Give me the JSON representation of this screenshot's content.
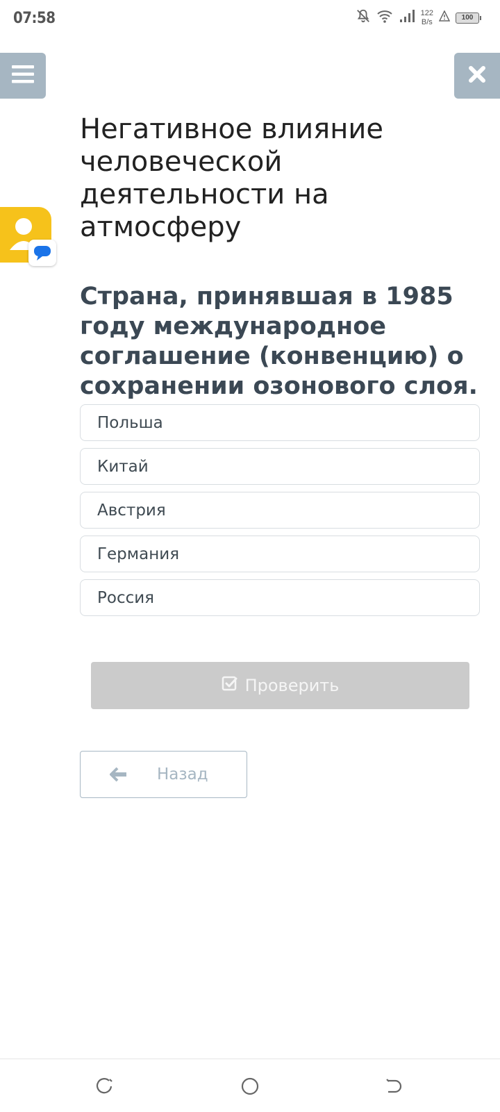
{
  "status_bar": {
    "time": "07:58",
    "net_speed_value": "122",
    "net_speed_unit": "B/s",
    "battery": "100",
    "icons": [
      "bell-off-icon",
      "wifi-icon",
      "signal-icon",
      "alert-icon",
      "battery-icon"
    ]
  },
  "header": {
    "menu_icon": "hamburger-icon",
    "close_icon": "close-icon"
  },
  "lesson": {
    "title": "Негативное влияние человеческой деятельности на атмосферу"
  },
  "question": {
    "text": "Страна, принявшая в 1985 году международное соглашение (конвенцию) о сохранении озонового слоя.",
    "options": [
      {
        "label": "Польша"
      },
      {
        "label": "Китай"
      },
      {
        "label": "Австрия"
      },
      {
        "label": "Германия"
      },
      {
        "label": "Россия"
      }
    ]
  },
  "actions": {
    "check_label": "Проверить",
    "back_label": "Назад"
  },
  "colors": {
    "header_button_bg": "#a6b6c2",
    "check_button_bg": "#cbcbcb",
    "avatar_bg": "#f6c21b",
    "chat_badge": "#1a73e8"
  }
}
